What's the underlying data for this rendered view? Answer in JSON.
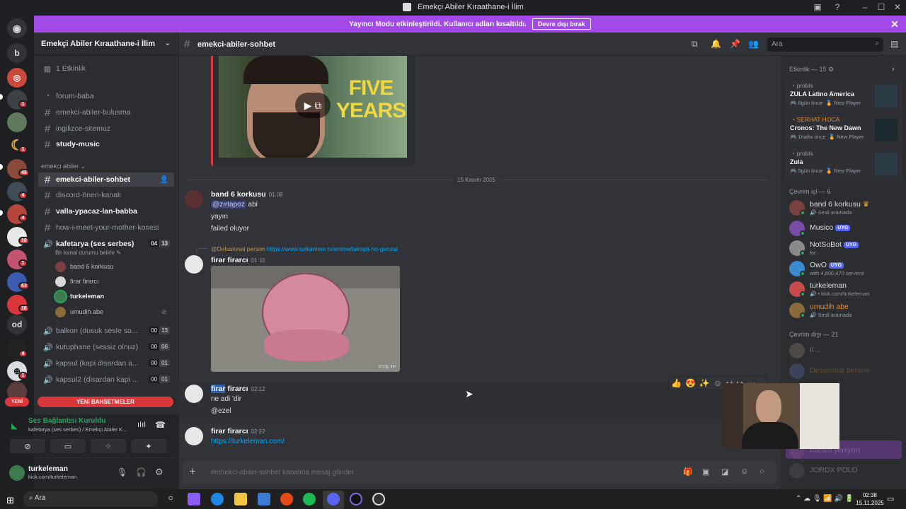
{
  "window": {
    "title": "Emekçi Abiler Kıraathane-i İlim"
  },
  "banner": {
    "text": "Yayıncı Modu etkinleştirildi. Kullanıcı adları kısaltıldı.",
    "button": "Devre dışı bırak"
  },
  "guilds": {
    "badges": [
      "1",
      "1",
      "49",
      "4",
      "4",
      "10",
      "1",
      "63",
      "16",
      "4",
      "1"
    ],
    "letters": [
      "b",
      "od"
    ],
    "new_label": "YENİ"
  },
  "server": {
    "name": "Emekçi Abiler Kıraathane-i İlim",
    "events": "1 Etkinlik",
    "channels": [
      {
        "name": "forum-baba"
      },
      {
        "name": "emekci-abiler-bulusma"
      },
      {
        "name": "ingilizce-sitemuz"
      },
      {
        "name": "study-music"
      }
    ],
    "category": "emekci abiler",
    "channels2": [
      {
        "name": "emekci-abiler-sohbet"
      },
      {
        "name": "discord-öneri-kanali"
      },
      {
        "name": "valla-ypacaz-lan-babba"
      },
      {
        "name": "how-i-meet-your-mother-kosesi"
      }
    ],
    "voice_channel": {
      "name": "kafetarya (ses serbes)",
      "status": "Bir kanal durumu belirle",
      "count_a": "04",
      "count_b": "13"
    },
    "voice_users": [
      "band 6 korkusu",
      "firar firarcı",
      "turkeleman",
      "umudih abe"
    ],
    "voice_channels": [
      {
        "name": "balkon (dusuk sesle so...",
        "a": "00",
        "b": "13"
      },
      {
        "name": "kutuphane (sessiz olnuz)",
        "a": "00",
        "b": "06"
      },
      {
        "name": "kapsul (kapi disardan a...",
        "a": "00",
        "b": "01"
      },
      {
        "name": "kapsul2 (disardan kapi ...",
        "a": "00",
        "b": "01"
      }
    ],
    "new_mentions": "YENİ BAHSETMELER"
  },
  "voice_panel": {
    "title": "Ses Bağlantısı Kuruldu",
    "subtitle": "kafetarya (ses serbes) / Emekçi Abiler K..."
  },
  "user_panel": {
    "name": "turkeleman",
    "status": "kick.com/turkeleman"
  },
  "chat": {
    "channel": "emekci-abiler-sohbet",
    "search_placeholder": "Ara",
    "video_text": "FIVE YEARS",
    "date_divider": "15 Kasım 2025",
    "messages": [
      {
        "author": "band 6 korkusu",
        "time": "01:08",
        "mention": "@zırtapoz",
        "lines": [
          "abi",
          "yayın",
          "failed oluyor"
        ]
      },
      {
        "author": "firar firarcı",
        "time": "01:10",
        "reply_to": "@Delusional person",
        "reply_link": "https://www.turkanime.tv/anime/takopii-no-genzai",
        "image_caption": "©TSL TF"
      },
      {
        "author_highlight": "firar",
        "author_rest": " firarcı",
        "time": "02:12",
        "lines": [
          "ne adi 'dir",
          "@ezel"
        ]
      },
      {
        "author": "firar firarcı",
        "time": "02:22",
        "link": "https://turkeleman.com/"
      }
    ],
    "input_placeholder": "#emekci-abiler-sohbet kanalına mesaj gönder"
  },
  "members": {
    "activity_title": "Etkinlik — 15",
    "activities": [
      {
        "user": "probis",
        "game": "ZULA Latino America",
        "meta": "6gün önce",
        "badge": "New Player"
      },
      {
        "user": "SERHAT HOCA",
        "game": "Cronos: The New Dawn",
        "meta": "1hafta önce",
        "badge": "New Player"
      },
      {
        "user": "probis",
        "game": "Zula",
        "meta": "5gün önce",
        "badge": "New Player"
      }
    ],
    "online_title": "Çevrim içi — 6",
    "online": [
      {
        "name": "band 6 korkusu",
        "status": "Sesli aramada"
      },
      {
        "name": "Musico",
        "tag": "UYG",
        "status": ""
      },
      {
        "name": "NotSoBot",
        "tag": "UYG",
        "status": "for ."
      },
      {
        "name": "OwO",
        "tag": "UYG",
        "status": "with 4,600,470 servers!"
      },
      {
        "name": "turkeleman",
        "status": "kick.com/turkeleman"
      },
      {
        "name": "umudih abe",
        "status": "Sesli aramada"
      }
    ],
    "offline_title": "Çevrim dışı — 21",
    "offline": [
      "II...",
      "Delusional person",
      "hacam yeniyort",
      "JORDX POLO"
    ]
  },
  "taskbar": {
    "search": "Ara",
    "time": "02:38",
    "date": "15.11.2025"
  },
  "colors": {
    "accent": "#5865f2",
    "banner": "#a349e8",
    "danger": "#da373c",
    "online": "#23a55a"
  }
}
